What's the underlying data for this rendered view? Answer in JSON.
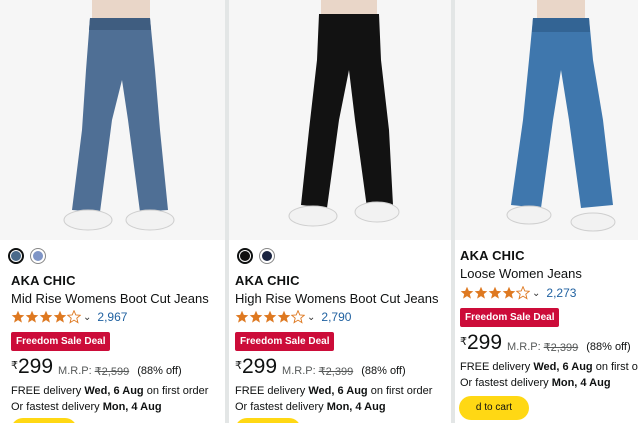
{
  "products": [
    {
      "swatches": [
        "#4a6a8a",
        "#7f95c6"
      ],
      "brand": "AKA CHIC",
      "title": "Mid Rise Womens Boot Cut Jeans",
      "rating": 4.0,
      "rating_count": "2,967",
      "deal": "Freedom Sale Deal",
      "currency": "₹",
      "price": "299",
      "mrp_label": "M.R.P:",
      "mrp": "₹2,599",
      "discount": "(88% off)",
      "delivery_prefix": "FREE delivery",
      "delivery_date": "Wed, 6 Aug",
      "delivery_suffix": "on first order",
      "fastest_prefix": "Or fastest delivery",
      "fastest_date": "Mon, 4 Aug"
    },
    {
      "swatches": [
        "#111111",
        "#1a2440"
      ],
      "brand": "AKA CHIC",
      "title": "High Rise Womens Boot Cut Jeans",
      "rating": 4.0,
      "rating_count": "2,790",
      "deal": "Freedom Sale Deal",
      "currency": "₹",
      "price": "299",
      "mrp_label": "M.R.P:",
      "mrp": "₹2,399",
      "discount": "(88% off)",
      "delivery_prefix": "FREE delivery",
      "delivery_date": "Wed, 6 Aug",
      "delivery_suffix": "on first order",
      "fastest_prefix": "Or fastest delivery",
      "fastest_date": "Mon, 4 Aug"
    },
    {
      "swatches": [],
      "brand": "AKA CHIC",
      "title": "Loose Women Jeans",
      "rating": 4.0,
      "rating_count": "2,273",
      "deal": "Freedom Sale Deal",
      "currency": "₹",
      "price": "299",
      "mrp_label": "M.R.P:",
      "mrp": "₹2,399",
      "discount": "(88% off)",
      "delivery_prefix": "FREE delivery",
      "delivery_date": "Wed, 6 Aug",
      "delivery_suffix": "on first ord",
      "fastest_prefix": "Or fastest delivery",
      "fastest_date": "Mon, 4 Aug",
      "cart_label": "d to cart"
    }
  ],
  "colors": {
    "deal_bg": "#cc0c39",
    "star": "#de7921",
    "link": "#2162a1",
    "cart_bg": "#ffd814"
  }
}
